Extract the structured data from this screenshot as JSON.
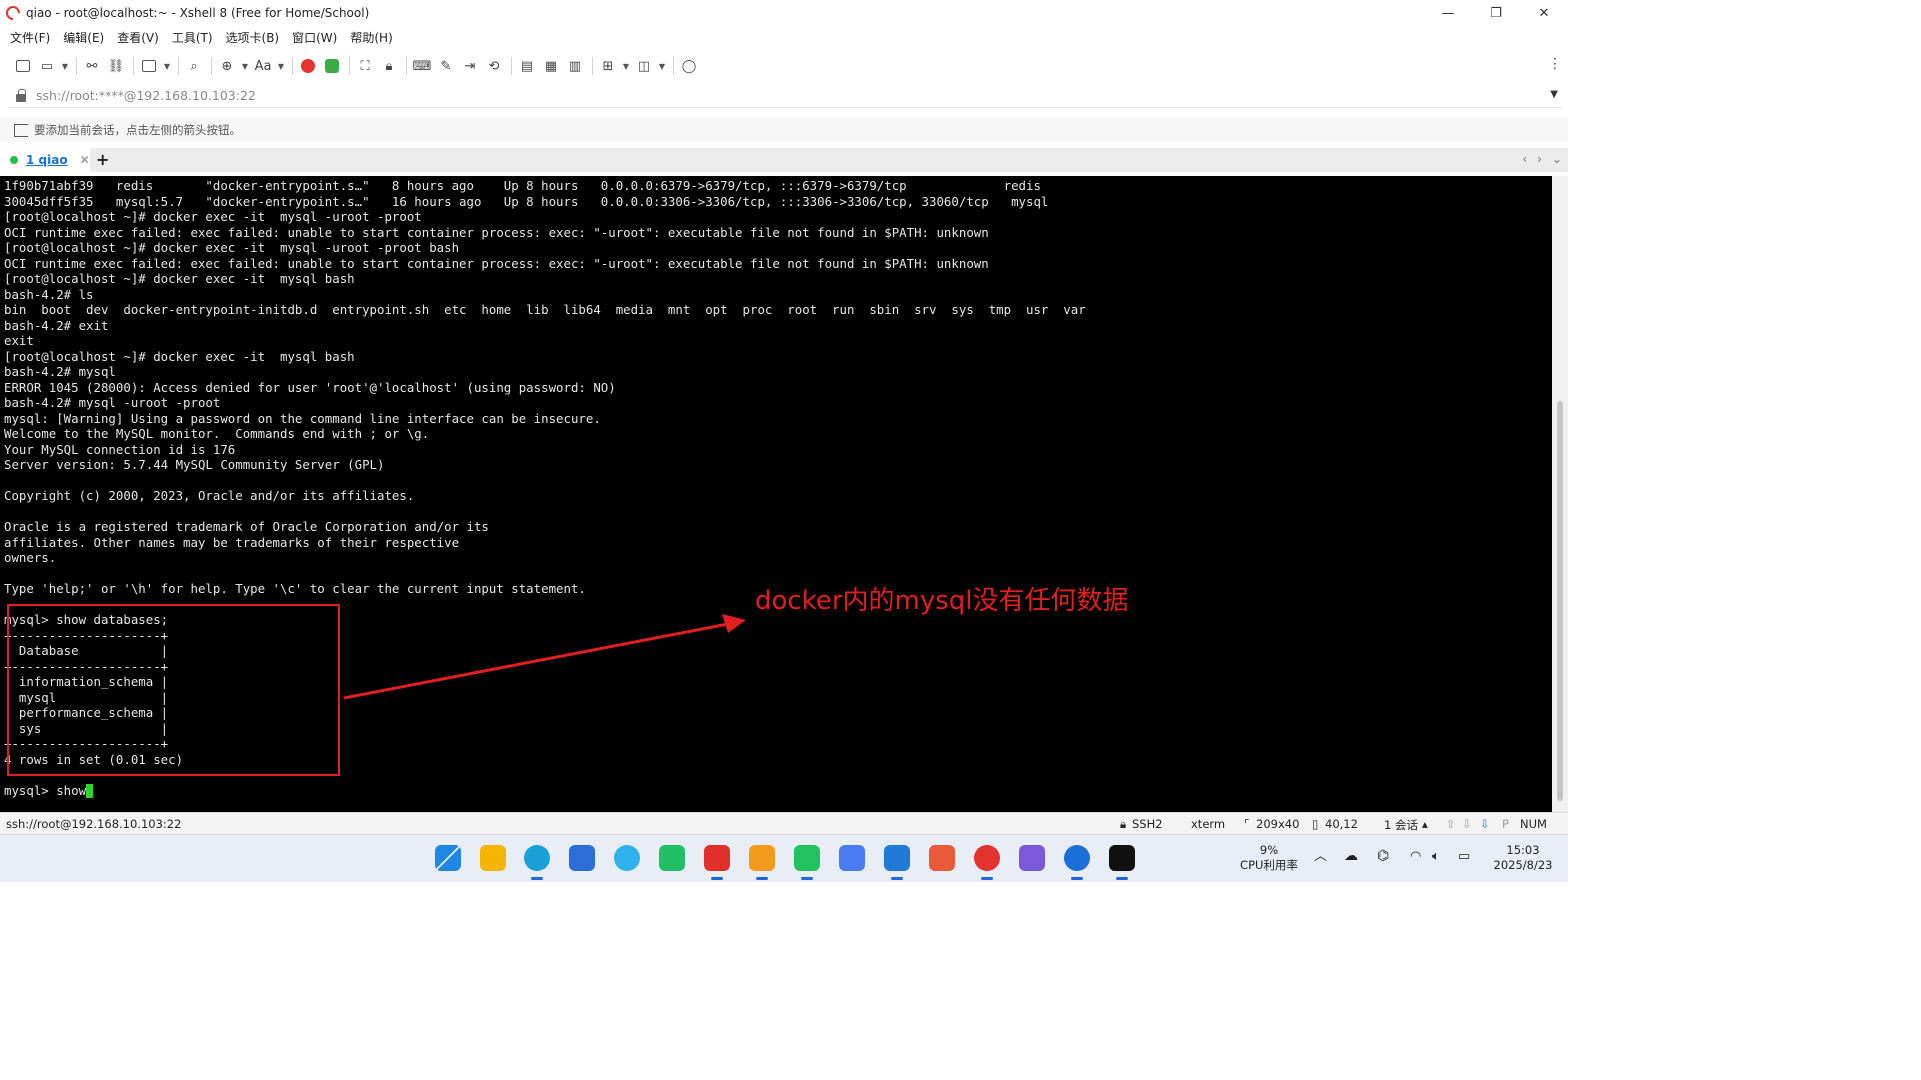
{
  "window": {
    "title": "qiao - root@localhost:~ - Xshell 8 (Free for Home/School)",
    "controls": {
      "minimize": "—",
      "maximize": "❐",
      "close": "✕"
    }
  },
  "menu": [
    "文件(F)",
    "编辑(E)",
    "查看(V)",
    "工具(T)",
    "选项卡(B)",
    "窗口(W)",
    "帮助(H)"
  ],
  "toolbar": {
    "font_label": "Aa"
  },
  "address": {
    "url": "ssh://root:****@192.168.10.103:22"
  },
  "hint": {
    "text": "要添加当前会话，点击左侧的箭头按钮。"
  },
  "tab": {
    "label": "1 qiao",
    "close": "✕",
    "add": "+"
  },
  "terminal": {
    "lines": [
      "1f90b71abf39   redis       \"docker-entrypoint.s…\"   8 hours ago    Up 8 hours   0.0.0.0:6379->6379/tcp, :::6379->6379/tcp             redis",
      "30045dff5f35   mysql:5.7   \"docker-entrypoint.s…\"   16 hours ago   Up 8 hours   0.0.0.0:3306->3306/tcp, :::3306->3306/tcp, 33060/tcp   mysql",
      "[root@localhost ~]# docker exec -it  mysql -uroot -proot",
      "OCI runtime exec failed: exec failed: unable to start container process: exec: \"-uroot\": executable file not found in $PATH: unknown",
      "[root@localhost ~]# docker exec -it  mysql -uroot -proot bash",
      "OCI runtime exec failed: exec failed: unable to start container process: exec: \"-uroot\": executable file not found in $PATH: unknown",
      "[root@localhost ~]# docker exec -it  mysql bash",
      "bash-4.2# ls",
      "bin  boot  dev  docker-entrypoint-initdb.d  entrypoint.sh  etc  home  lib  lib64  media  mnt  opt  proc  root  run  sbin  srv  sys  tmp  usr  var",
      "bash-4.2# exit",
      "exit",
      "[root@localhost ~]# docker exec -it  mysql bash",
      "bash-4.2# mysql",
      "ERROR 1045 (28000): Access denied for user 'root'@'localhost' (using password: NO)",
      "bash-4.2# mysql -uroot -proot",
      "mysql: [Warning] Using a password on the command line interface can be insecure.",
      "Welcome to the MySQL monitor.  Commands end with ; or \\g.",
      "Your MySQL connection id is 176",
      "Server version: 5.7.44 MySQL Community Server (GPL)",
      "",
      "Copyright (c) 2000, 2023, Oracle and/or its affiliates.",
      "",
      "Oracle is a registered trademark of Oracle Corporation and/or its",
      "affiliates. Other names may be trademarks of their respective",
      "owners.",
      "",
      "Type 'help;' or '\\h' for help. Type '\\c' to clear the current input statement.",
      "",
      "mysql> show databases;",
      "+--------------------+",
      "| Database           |",
      "+--------------------+",
      "| information_schema |",
      "| mysql              |",
      "| performance_schema |",
      "| sys                |",
      "+--------------------+",
      "4 rows in set (0.01 sec)",
      ""
    ],
    "prompt_line": "mysql> show"
  },
  "annotation": {
    "text": "docker内的mysql没有任何数据",
    "color": "#e11f1f"
  },
  "status": {
    "session": "ssh://root@192.168.10.103:22",
    "protocol": "SSH2",
    "term": "xterm",
    "size": "209x40",
    "cursor_pos": "40,12",
    "sessions": "1 会话",
    "num": "NUM"
  },
  "taskbar": {
    "cpu_percent": "9%",
    "cpu_label": "CPU利用率",
    "time": "15:03",
    "date": "2025/8/23"
  }
}
